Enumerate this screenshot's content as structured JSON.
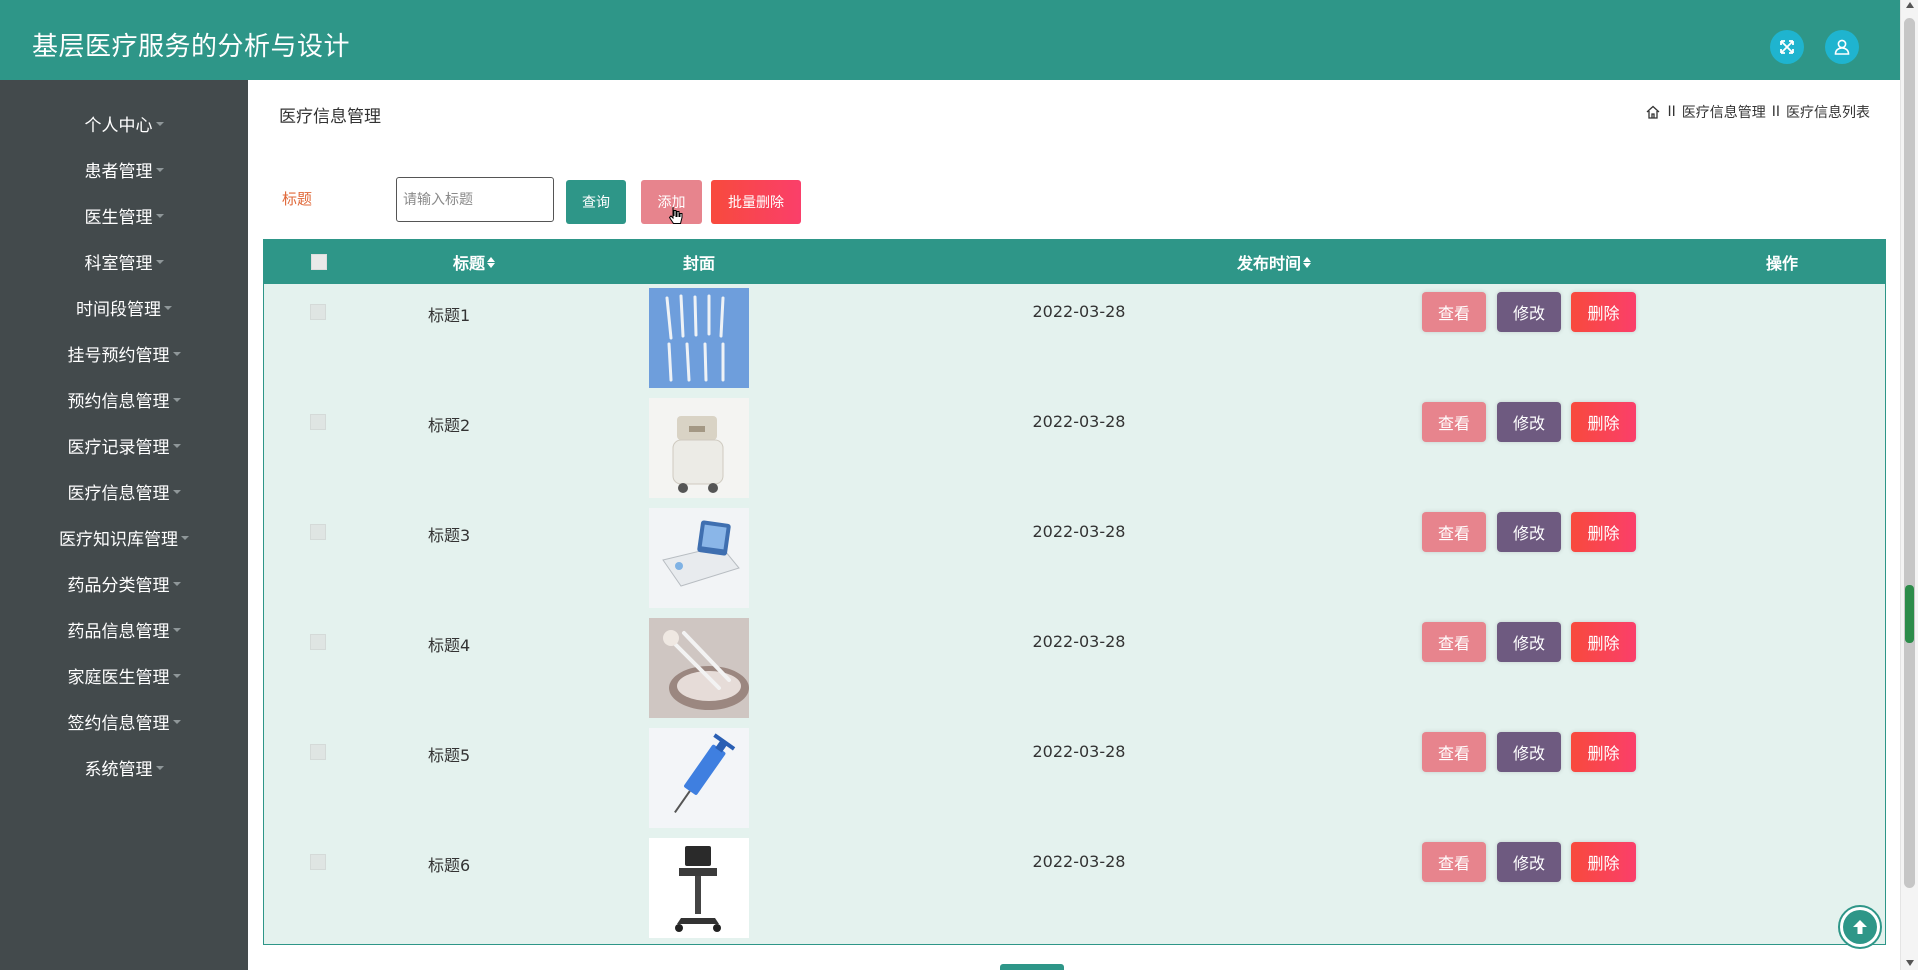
{
  "app": {
    "title": "基层医疗服务的分析与设计"
  },
  "header": {
    "fullscreen_icon": "expand-icon",
    "user_icon": "user-icon",
    "accent": "#2e9688"
  },
  "sidebar": {
    "items": [
      {
        "label": "个人中心"
      },
      {
        "label": "患者管理"
      },
      {
        "label": "医生管理"
      },
      {
        "label": "科室管理"
      },
      {
        "label": "时间段管理"
      },
      {
        "label": "挂号预约管理"
      },
      {
        "label": "预约信息管理"
      },
      {
        "label": "医疗记录管理"
      },
      {
        "label": "医疗信息管理"
      },
      {
        "label": "医疗知识库管理"
      },
      {
        "label": "药品分类管理"
      },
      {
        "label": "药品信息管理"
      },
      {
        "label": "家庭医生管理"
      },
      {
        "label": "签约信息管理"
      },
      {
        "label": "系统管理"
      }
    ]
  },
  "page": {
    "title": "医疗信息管理",
    "breadcrumb": {
      "home_icon": "home-icon",
      "sep": "II",
      "level1": "医疗信息管理",
      "level2": "医疗信息列表"
    }
  },
  "search": {
    "label": "标题",
    "placeholder": "请输入标题",
    "value": ""
  },
  "toolbar": {
    "query_label": "查询",
    "add_label": "添加",
    "batch_delete_label": "批量删除"
  },
  "table": {
    "columns": {
      "title": "标题",
      "cover": "封面",
      "publish_time": "发布时间",
      "actions": "操作"
    },
    "action_labels": {
      "view": "查看",
      "edit": "修改",
      "delete": "删除"
    },
    "rows": [
      {
        "title": "标题1",
        "date": "2022-03-28",
        "cover_icon": "surgical-instruments-image"
      },
      {
        "title": "标题2",
        "date": "2022-03-28",
        "cover_icon": "medical-cart-image"
      },
      {
        "title": "标题3",
        "date": "2022-03-28",
        "cover_icon": "medical-device-image"
      },
      {
        "title": "标题4",
        "date": "2022-03-28",
        "cover_icon": "dental-tools-image"
      },
      {
        "title": "标题5",
        "date": "2022-03-28",
        "cover_icon": "syringe-image"
      },
      {
        "title": "标题6",
        "date": "2022-03-28",
        "cover_icon": "ultrasound-machine-image"
      }
    ]
  }
}
